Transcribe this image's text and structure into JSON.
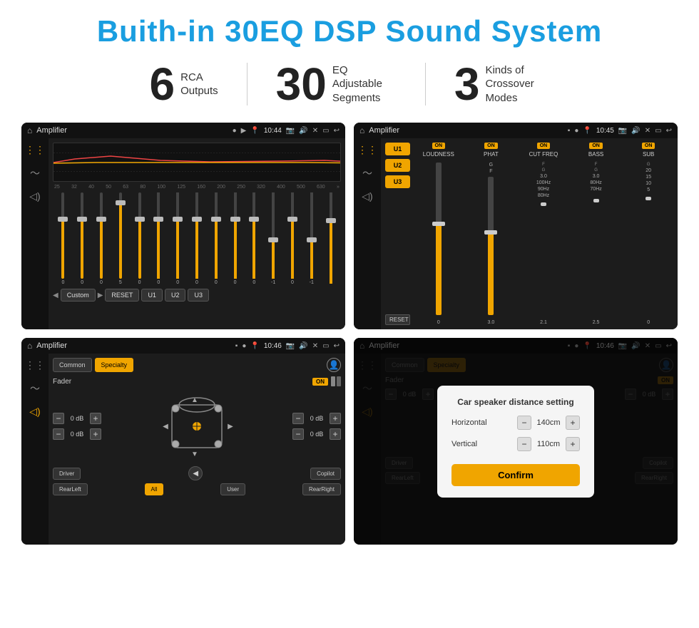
{
  "page": {
    "title": "Buith-in 30EQ DSP Sound System"
  },
  "stats": [
    {
      "number": "6",
      "label": "RCA\nOutputs"
    },
    {
      "number": "30",
      "label": "EQ Adjustable\nSegments"
    },
    {
      "number": "3",
      "label": "Kinds of\nCrossover Modes"
    }
  ],
  "screens": [
    {
      "id": "screen1",
      "title": "Amplifier",
      "time": "10:44",
      "type": "eq"
    },
    {
      "id": "screen2",
      "title": "Amplifier",
      "time": "10:45",
      "type": "crossover"
    },
    {
      "id": "screen3",
      "title": "Amplifier",
      "time": "10:46",
      "type": "fader"
    },
    {
      "id": "screen4",
      "title": "Amplifier",
      "time": "10:46",
      "type": "distance"
    }
  ],
  "eq": {
    "frequencies": [
      "25",
      "32",
      "40",
      "50",
      "63",
      "80",
      "100",
      "125",
      "160",
      "200",
      "250",
      "320",
      "400",
      "500",
      "630"
    ],
    "values": [
      "0",
      "0",
      "0",
      "5",
      "0",
      "0",
      "0",
      "0",
      "0",
      "0",
      "0",
      "-1",
      "0",
      "-1",
      ""
    ],
    "preset": "Custom",
    "buttons": [
      "RESET",
      "U1",
      "U2",
      "U3"
    ]
  },
  "crossover": {
    "presets": [
      "U1",
      "U2",
      "U3"
    ],
    "channels": [
      "LOUDNESS",
      "PHAT",
      "CUT FREQ",
      "BASS",
      "SUB"
    ],
    "resetLabel": "RESET"
  },
  "fader": {
    "tabs": [
      "Common",
      "Specialty"
    ],
    "faderLabel": "Fader",
    "onLabel": "ON",
    "dbValues": [
      "0 dB",
      "0 dB",
      "0 dB",
      "0 dB"
    ],
    "buttons": {
      "driver": "Driver",
      "copilot": "Copilot",
      "rearLeft": "RearLeft",
      "all": "All",
      "user": "User",
      "rearRight": "RearRight"
    }
  },
  "dialog": {
    "title": "Car speaker distance setting",
    "horizontal": {
      "label": "Horizontal",
      "value": "140cm"
    },
    "vertical": {
      "label": "Vertical",
      "value": "110cm"
    },
    "confirmLabel": "Confirm",
    "dbValues": [
      "0 dB",
      "0 dB"
    ]
  }
}
